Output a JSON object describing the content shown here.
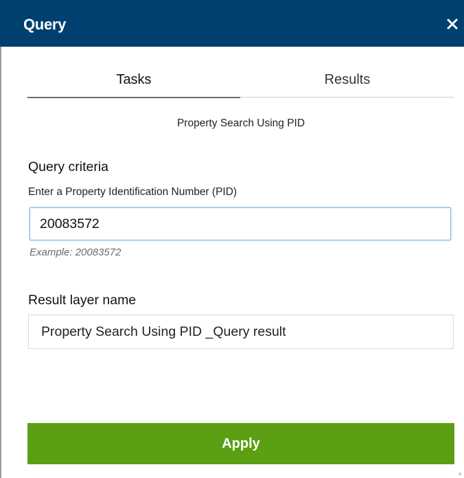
{
  "window": {
    "title": "Query",
    "close_icon": "close-icon",
    "header_color": "#00406e"
  },
  "tabs": [
    {
      "label": "Tasks",
      "active": true
    },
    {
      "label": "Results",
      "active": false
    }
  ],
  "task": {
    "title": "Property Search Using PID"
  },
  "criteria": {
    "heading": "Query criteria",
    "field_label": "Enter a Property Identification Number (PID)",
    "value": "20083572",
    "hint": "Example: 20083572"
  },
  "result_layer": {
    "heading": "Result layer name",
    "value": "Property Search Using PID _Query result"
  },
  "actions": {
    "apply_label": "Apply",
    "apply_color": "#5aa012"
  }
}
